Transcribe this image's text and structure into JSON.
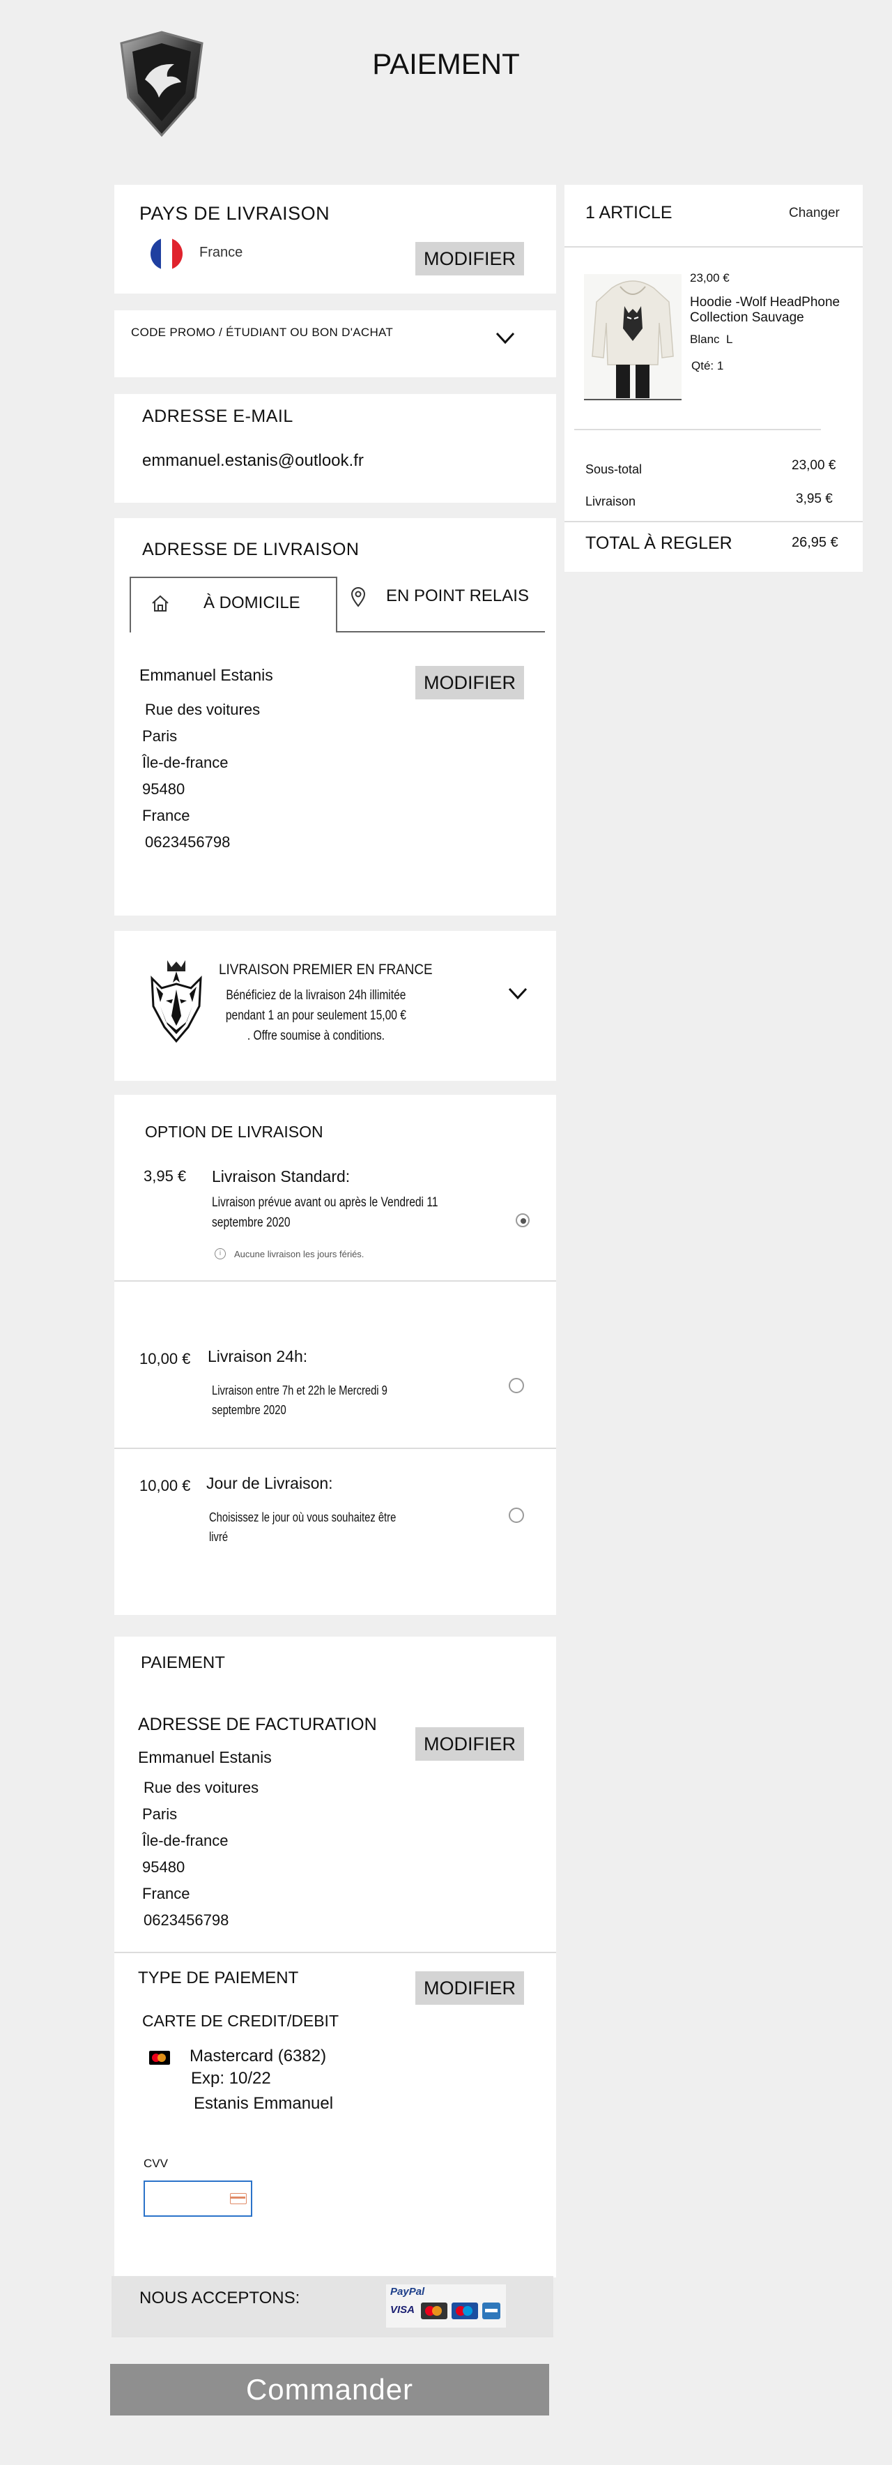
{
  "header": {
    "title": "PAIEMENT"
  },
  "country": {
    "heading": "PAYS DE LIVRAISON",
    "value": "France",
    "modify_label": "MODIFIER"
  },
  "promo": {
    "label": "CODE PROMO / ÉTUDIANT OU BON D'ACHAT"
  },
  "email": {
    "heading": "ADRESSE E-MAIL",
    "value": "emmanuel.estanis@outlook.fr"
  },
  "shipping_address": {
    "heading": "ADRESSE DE LIVRAISON",
    "tabs": [
      {
        "label": "À DOMICILE"
      },
      {
        "label": "EN POINT RELAIS"
      }
    ],
    "name": "Emmanuel Estanis",
    "lines": [
      "Rue des voitures",
      "Paris",
      "Île-de-france",
      "95480",
      "France",
      "0623456798"
    ],
    "modify_label": "MODIFIER"
  },
  "premier": {
    "title": "LIVRAISON PREMIER EN FRANCE",
    "desc": [
      "Bénéficiez de la livraison 24h illimitée",
      "pendant 1 an pour seulement 15,00 €",
      ". Offre soumise à conditions."
    ]
  },
  "delivery_options": {
    "heading": "OPTION DE LIVRAISON",
    "options": [
      {
        "price": "3,95 €",
        "name": "Livraison Standard:",
        "desc": [
          "Livraison prévue avant ou après le Vendredi 11",
          "septembre 2020"
        ],
        "note": "Aucune livraison les jours fériés.",
        "selected": true
      },
      {
        "price": "10,00 €",
        "name": "Livraison 24h:",
        "desc": [
          "Livraison entre 7h et 22h le Mercredi 9",
          "septembre 2020"
        ],
        "selected": false
      },
      {
        "price": "10,00 €",
        "name": "Jour de Livraison:",
        "desc": [
          "Choisissez le jour où vous souhaitez être",
          "livré"
        ],
        "selected": false
      }
    ]
  },
  "payment": {
    "heading": "PAIEMENT",
    "billing_heading": "ADRESSE DE FACTURATION",
    "billing_name": "Emmanuel Estanis",
    "billing_lines": [
      "Rue des voitures",
      "Paris",
      "Île-de-france",
      "95480",
      "France",
      "0623456798"
    ],
    "modify_label": "MODIFIER",
    "type_heading": "TYPE DE PAIEMENT",
    "type_modify_label": "MODIFIER",
    "card_heading": "CARTE DE CREDIT/DEBIT",
    "card_name": "Mastercard (6382)",
    "card_exp": "Exp: 10/22",
    "card_holder": "Estanis Emmanuel",
    "cvv_label": "CVV",
    "cvv_value": "",
    "accept_label": "NOUS ACCEPTONS:",
    "paypal_label": "PayPal",
    "visa_label": "VISA"
  },
  "order_button": {
    "label": "Commander"
  },
  "summary": {
    "count_label": "1 ARTICLE",
    "change_label": "Changer",
    "item": {
      "price": "23,00 €",
      "name_lines": [
        "Hoodie -Wolf HeadPhone",
        "Collection Sauvage"
      ],
      "variant": "Blanc  L",
      "qty": "Qté: 1"
    },
    "subtotal_label": "Sous-total",
    "subtotal_value": "23,00 €",
    "shipping_label": "Livraison",
    "shipping_value": "3,95 €",
    "total_label": "TOTAL À REGLER",
    "total_value": "26,95 €"
  }
}
